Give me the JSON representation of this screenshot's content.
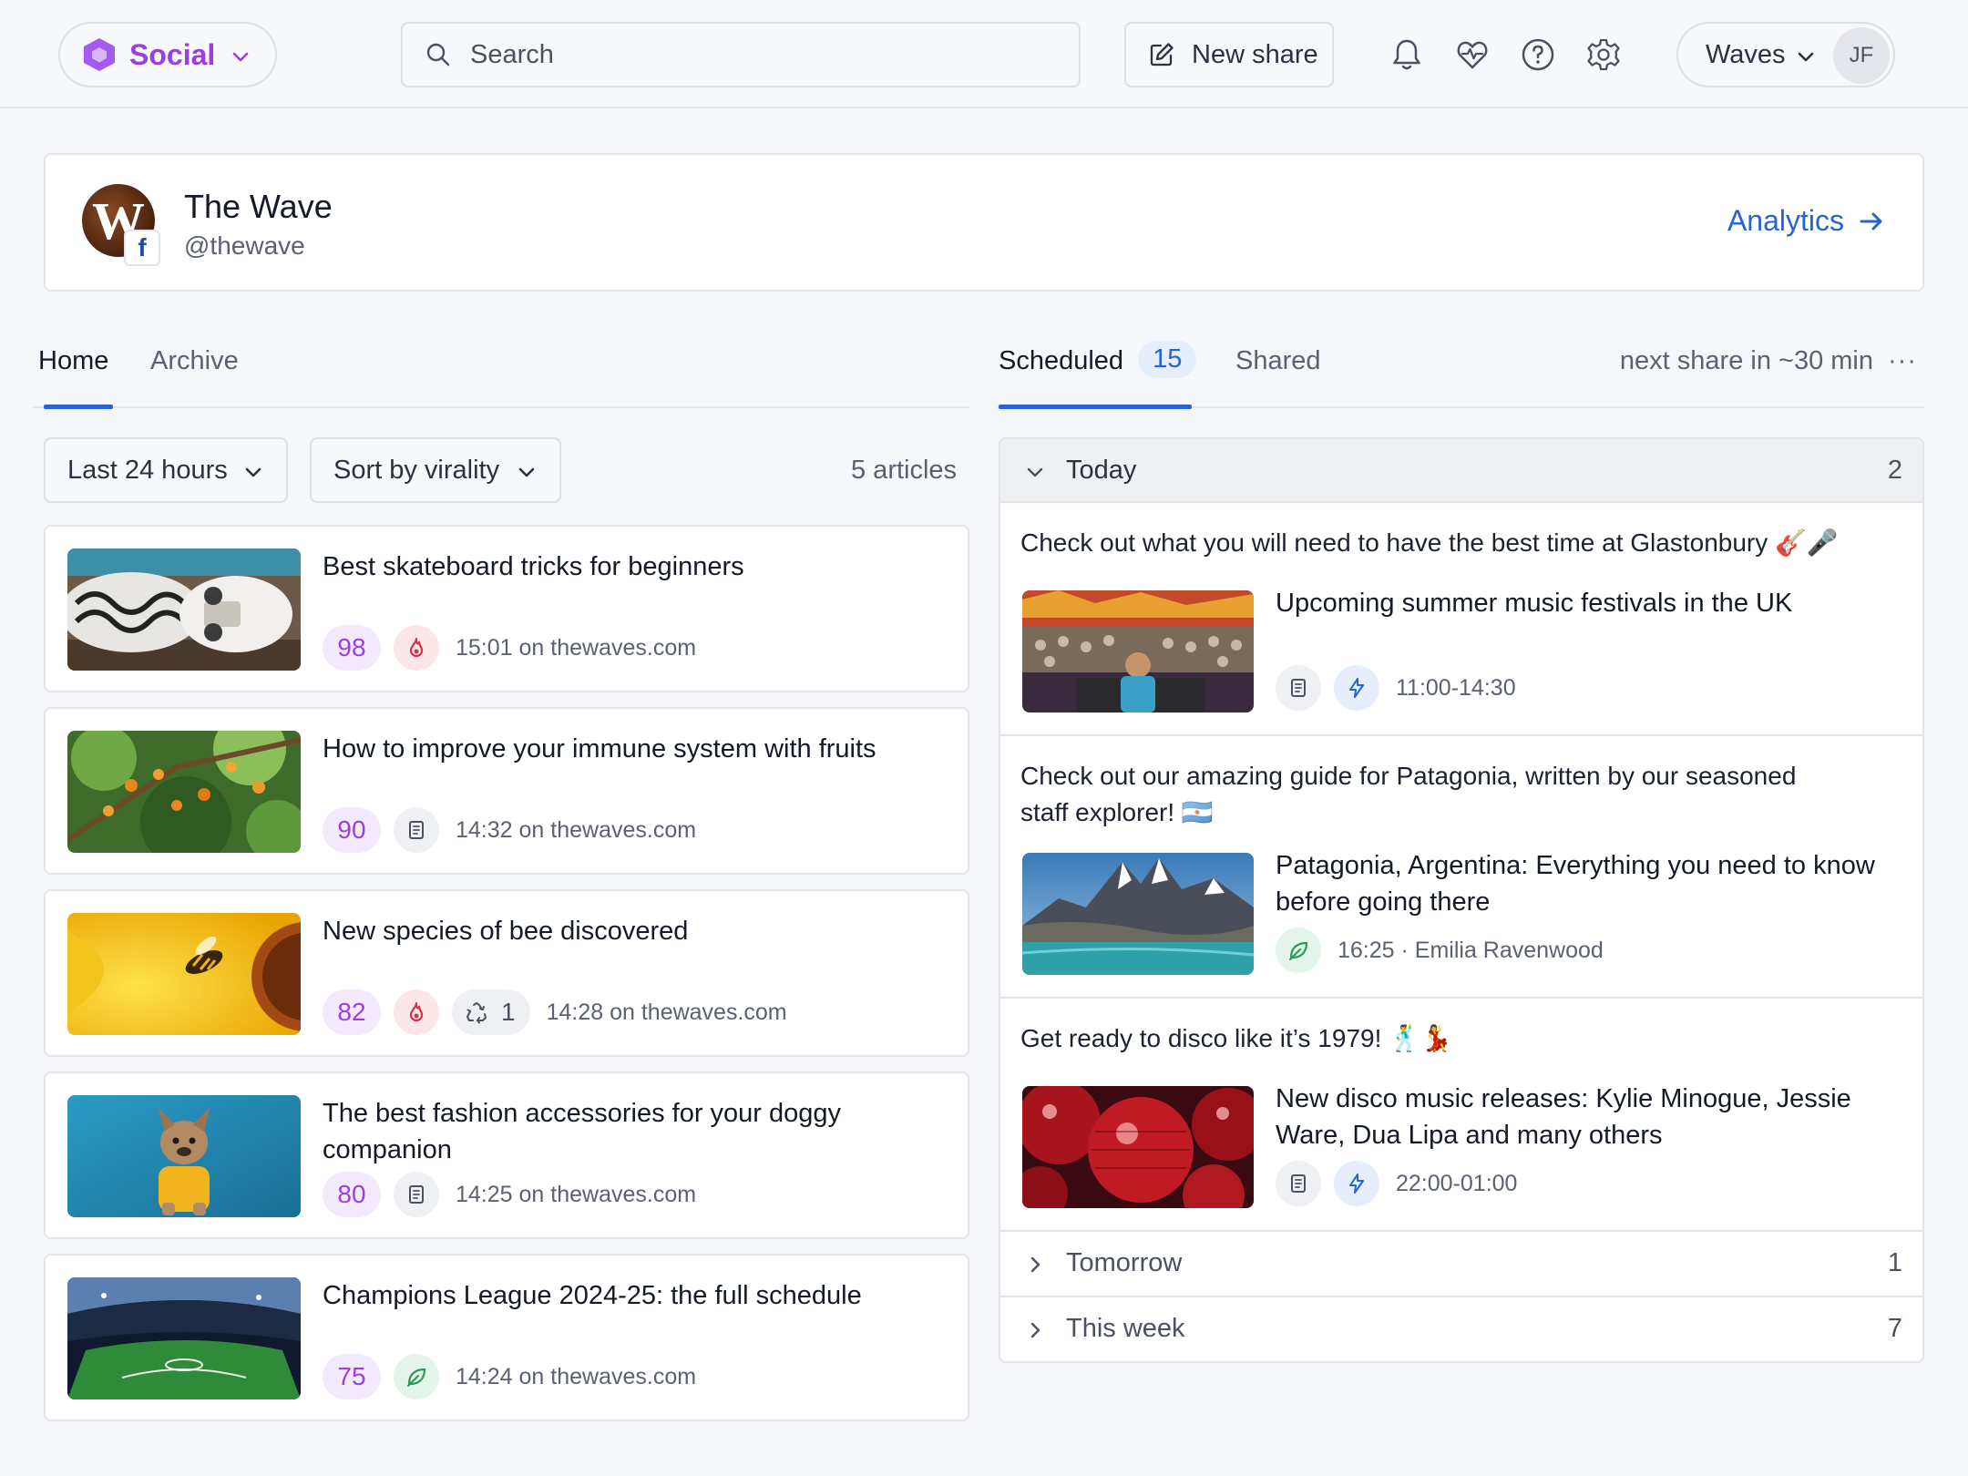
{
  "header": {
    "app_label": "Social",
    "search_placeholder": "Search",
    "new_share_label": "New share",
    "account_label": "Waves",
    "avatar_initials": "JF"
  },
  "profile": {
    "avatar_letter": "W",
    "name": "The Wave",
    "handle": "@thewave",
    "analytics_label": "Analytics"
  },
  "left_tabs": [
    {
      "label": "Home",
      "active": true
    },
    {
      "label": "Archive",
      "active": false
    }
  ],
  "right_tabs": {
    "scheduled_label": "Scheduled",
    "scheduled_count": "15",
    "shared_label": "Shared",
    "next_share": "next share in ~30 min",
    "more": "···"
  },
  "filters": {
    "time_range": "Last 24 hours",
    "sort": "Sort by virality",
    "count": "5 articles"
  },
  "articles": [
    {
      "title": "Best skateboard tricks for beginners",
      "score": "98",
      "icon": "flame-icon",
      "time": "15:01 on thewaves.com"
    },
    {
      "title": "How to improve your immune system with fruits",
      "score": "90",
      "icon": "document-icon",
      "time": "14:32 on thewaves.com"
    },
    {
      "title": "New species of bee discovered",
      "score": "82",
      "icon": "flame-icon",
      "recycle_count": "1",
      "time": "14:28 on thewaves.com"
    },
    {
      "title": "The best fashion accessories for your doggy companion",
      "score": "80",
      "icon": "document-icon",
      "time": "14:25 on thewaves.com"
    },
    {
      "title": "Champions League 2024-25: the full schedule",
      "score": "75",
      "icon": "leaf-icon",
      "time": "14:24 on thewaves.com"
    }
  ],
  "schedule": {
    "today": {
      "label": "Today",
      "count": "2"
    },
    "items": [
      {
        "message": "Check out what you will need to have the best time at Glastonbury 🎸🎤",
        "title": "Upcoming summer music festivals in the UK",
        "meta": "11:00-14:30",
        "icons": [
          "document-icon",
          "bolt-icon"
        ]
      },
      {
        "message": "Check out our amazing guide for Patagonia, written by our seasoned staff explorer! 🇦🇷",
        "title": "Patagonia, Argentina: Everything you need to know before going there",
        "meta": "16:25 · Emilia Ravenwood",
        "icons": [
          "leaf-icon"
        ]
      },
      {
        "message": "Get ready to disco like it’s 1979! 🕺💃",
        "title": "New disco music releases: Kylie Minogue, Jessie Ware, Dua Lipa and many others",
        "meta": "22:00-01:00",
        "icons": [
          "document-icon",
          "bolt-icon"
        ]
      }
    ],
    "tomorrow": {
      "label": "Tomorrow",
      "count": "1"
    },
    "this_week": {
      "label": "This week",
      "count": "7"
    }
  },
  "colors": {
    "accent_blue": "#2563d6",
    "brand_purple": "#9b3fe0",
    "flame_red": "#d6304a",
    "leaf_green": "#2e9a58"
  }
}
